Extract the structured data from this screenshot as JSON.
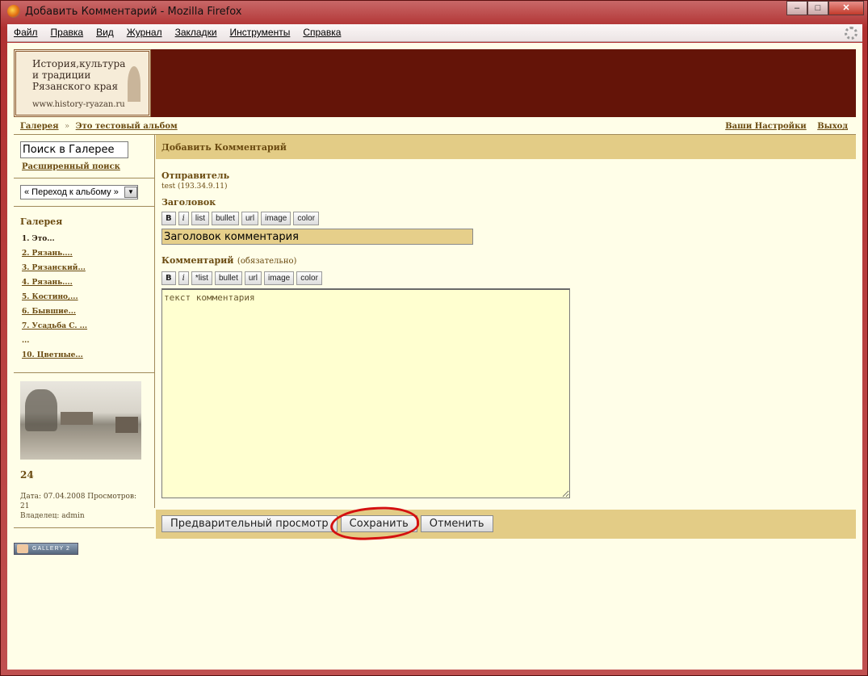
{
  "window": {
    "title": "Добавить Комментарий - Mozilla Firefox",
    "min": "–",
    "max": "□",
    "close": "✕"
  },
  "menubar": {
    "items": [
      "Файл",
      "Правка",
      "Вид",
      "Журнал",
      "Закладки",
      "Инструменты",
      "Справка"
    ]
  },
  "banner": {
    "logo_line1": "История,культура",
    "logo_line2": "и традиции",
    "logo_line3": "Рязанского края",
    "logo_url": "www.history-ryazan.ru"
  },
  "breadcrumb": {
    "gallery": "Галерея",
    "separator": "»",
    "album": "Это тестовый альбом"
  },
  "userlinks": {
    "settings": "Ваши Настройки",
    "logout": "Выход"
  },
  "sidebar": {
    "search_value": "Поиск в Галерее",
    "advanced_search": "Расширенный поиск",
    "jump_select": "« Переход к альбому »",
    "gallery_heading": "Галерея",
    "albums": [
      "1. Это...",
      "2. Рязань....",
      "3. Рязанский...",
      "4. Рязань....",
      "5. Костино,...",
      "6. Бывшие...",
      "7. Усадьба С. ...",
      "...",
      "10. Цветные..."
    ],
    "item_title": "24",
    "item_meta_line1": "Дата: 07.04.2008 Просмотров: 21",
    "item_meta_line2": "Владелец: admin"
  },
  "main": {
    "header": "Добавить Комментарий",
    "sender_label": "Отправитель",
    "sender_value": "test (193.34.9.11)",
    "subject_label": "Заголовок",
    "subject_value": "Заголовок комментария",
    "comment_label": "Комментарий",
    "comment_required": "(обязательно)",
    "comment_value": "текст комментария",
    "toolbar1": [
      "B",
      "i",
      "list",
      "bullet",
      "url",
      "image",
      "color"
    ],
    "toolbar2": [
      "B",
      "i",
      "*list",
      "bullet",
      "url",
      "image",
      "color"
    ]
  },
  "buttons": {
    "preview": "Предварительный просмотр",
    "save": "Сохранить",
    "cancel": "Отменить"
  },
  "badge": {
    "text": "GALLERY 2"
  },
  "colors": {
    "banner": "#641408",
    "header_bar": "#e3cc86",
    "link": "#6a4a10",
    "highlight_circle": "#d41010"
  }
}
